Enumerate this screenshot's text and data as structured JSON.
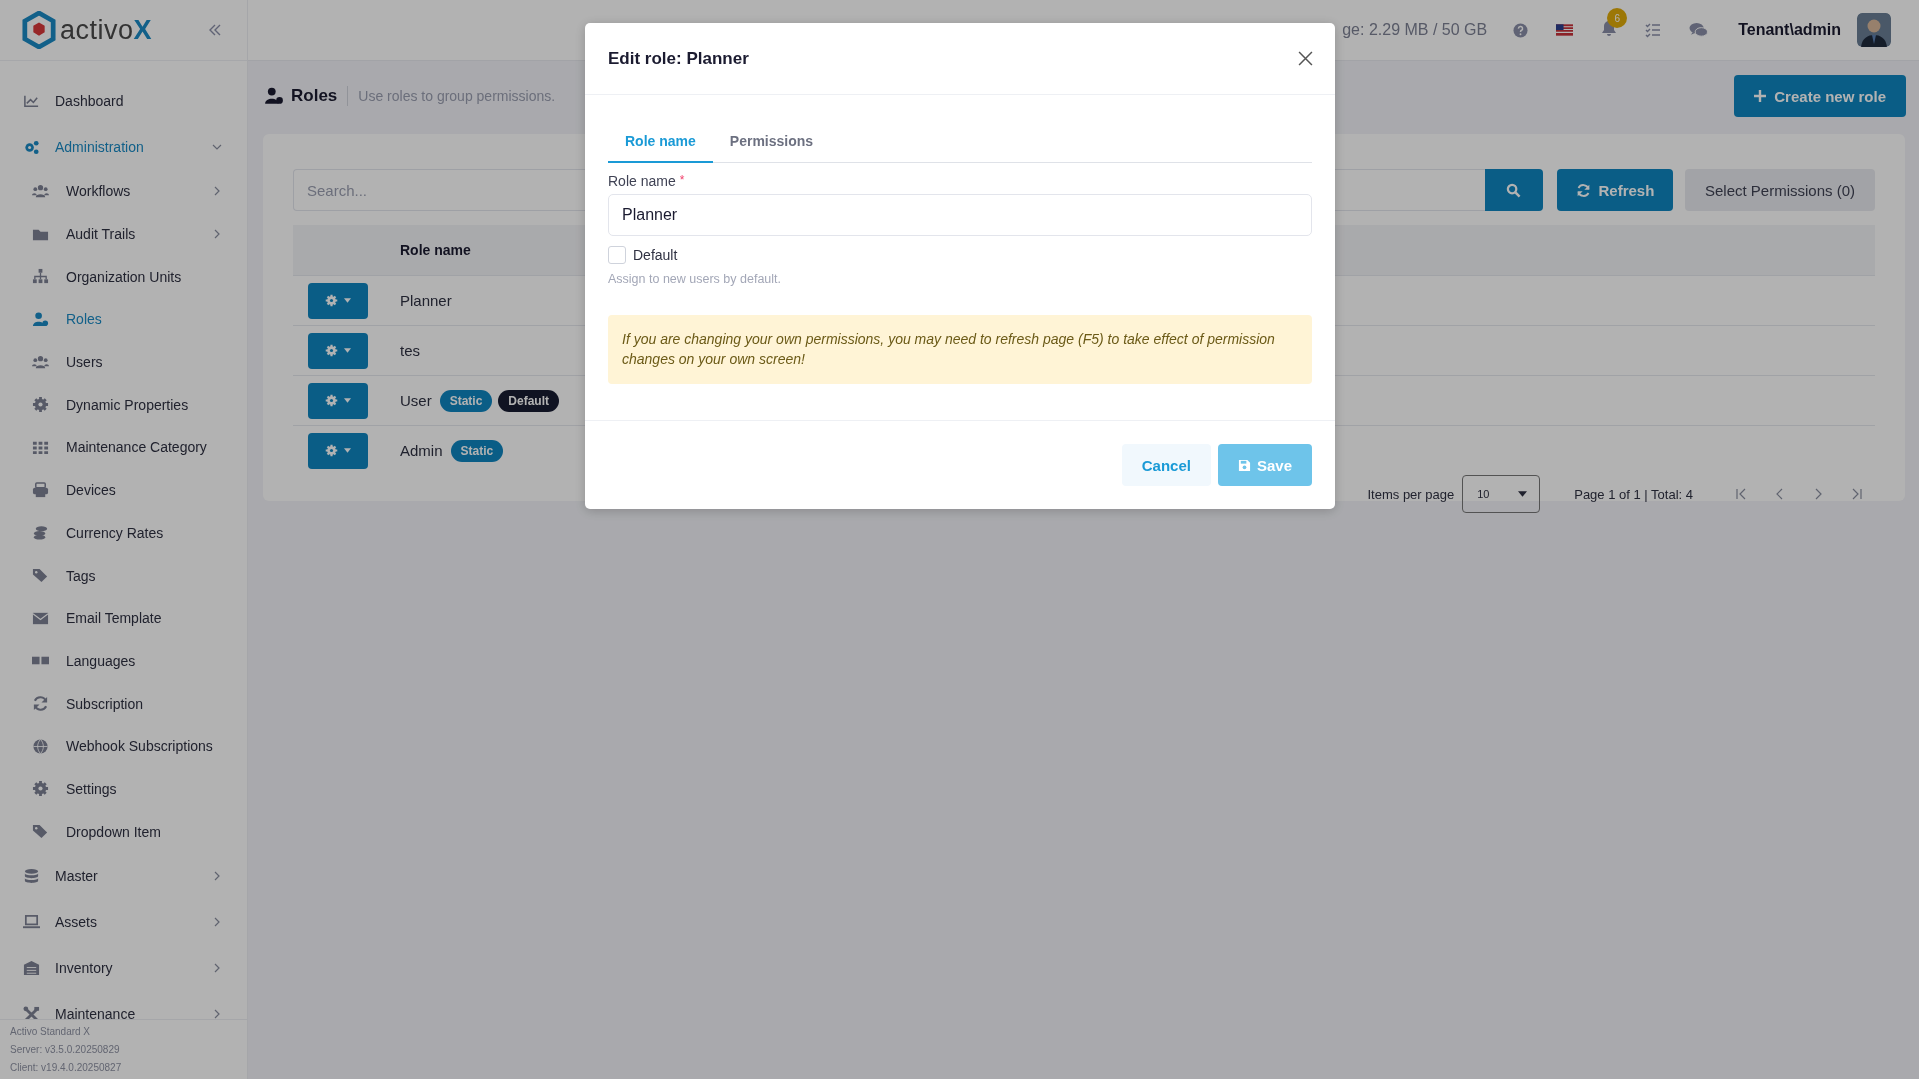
{
  "app": {
    "logo_text": "activo",
    "logo_accent": "X"
  },
  "topbar": {
    "storage": "ge: 2.29 MB / 50 GB",
    "notification_count": "6",
    "user": "Tenant\\admin"
  },
  "sidebar": {
    "items": [
      {
        "label": "Dashboard",
        "selected": false
      },
      {
        "label": "Administration",
        "selected": true,
        "expanded": true,
        "children": [
          {
            "label": "Workflows",
            "selected": false,
            "expanded": false
          },
          {
            "label": "Audit Trails",
            "selected": false,
            "expanded": false
          },
          {
            "label": "Organization Units",
            "selected": false
          },
          {
            "label": "Roles",
            "selected": true
          },
          {
            "label": "Users",
            "selected": false
          },
          {
            "label": "Dynamic Properties",
            "selected": false
          },
          {
            "label": "Maintenance Category",
            "selected": false
          },
          {
            "label": "Devices",
            "selected": false
          },
          {
            "label": "Currency Rates",
            "selected": false
          },
          {
            "label": "Tags",
            "selected": false
          },
          {
            "label": "Email Template",
            "selected": false
          },
          {
            "label": "Languages",
            "selected": false
          },
          {
            "label": "Subscription",
            "selected": false
          },
          {
            "label": "Webhook Subscriptions",
            "selected": false
          },
          {
            "label": "Settings",
            "selected": false
          },
          {
            "label": "Dropdown Item",
            "selected": false
          }
        ]
      },
      {
        "label": "Master",
        "selected": false,
        "expanded": false
      },
      {
        "label": "Assets",
        "selected": false,
        "expanded": false
      },
      {
        "label": "Inventory",
        "selected": false,
        "expanded": false
      },
      {
        "label": "Maintenance",
        "selected": false,
        "expanded": false
      }
    ],
    "footer": [
      "Activo Standard X",
      "Server: v3.5.0.20250829",
      "Client: v19.4.0.20250827"
    ]
  },
  "page": {
    "title": "Roles",
    "description": "Use roles to group permissions.",
    "create_button": "Create new role"
  },
  "toolbar": {
    "search_placeholder": "Search...",
    "refresh_button": "Refresh",
    "select_permissions_button": "Select Permissions (0)"
  },
  "table": {
    "columns": [
      "Role name"
    ],
    "rows": [
      {
        "name": "Planner",
        "badges": []
      },
      {
        "name": "tes",
        "badges": []
      },
      {
        "name": "User",
        "badges": [
          {
            "label": "Static",
            "kind": "static"
          },
          {
            "label": "Default",
            "kind": "default"
          }
        ]
      },
      {
        "name": "Admin",
        "badges": [
          {
            "label": "Static",
            "kind": "static"
          }
        ]
      }
    ]
  },
  "pagination": {
    "items_per_page_label": "Items per page",
    "page_size": "10",
    "summary": "Page 1 of 1 | Total: 4"
  },
  "modal": {
    "title": "Edit role: Planner",
    "tabs": [
      {
        "label": "Role name",
        "selected": true
      },
      {
        "label": "Permissions",
        "selected": false
      }
    ],
    "field_label": "Role name",
    "required_mark": "*",
    "value": "Planner",
    "default_checkbox": {
      "label": "Default",
      "checked": false
    },
    "hint": "Assign to new users by default.",
    "alert": "If you are changing your own permissions, you may need to refresh page (F5) to take effect of permission changes on your own screen!",
    "cancel_button": "Cancel",
    "save_button": "Save",
    "save_disabled": true
  }
}
